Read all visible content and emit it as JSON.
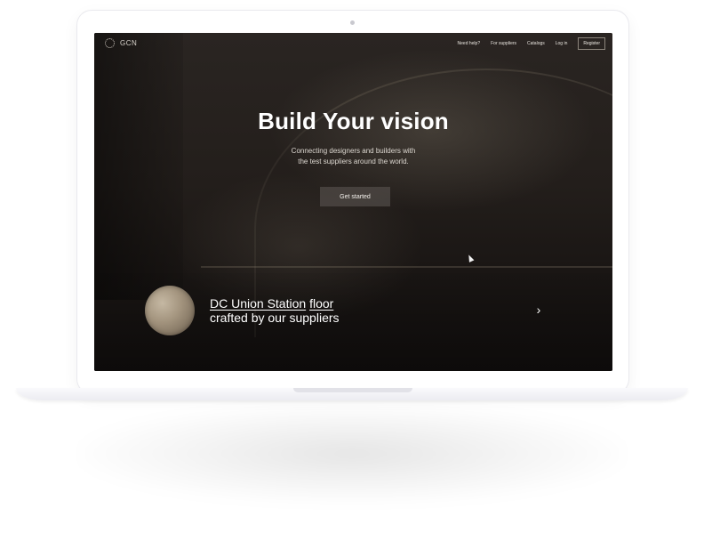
{
  "brand": {
    "logo_text": "GCN",
    "logo_icon": "dotted-ring-icon"
  },
  "nav": {
    "items": [
      {
        "label": "Need help?"
      },
      {
        "label": "For suppliers"
      },
      {
        "label": "Catalogs"
      },
      {
        "label": "Log in"
      }
    ],
    "register_label": "Register"
  },
  "hero": {
    "title": "Build Your vision",
    "subtitle_line1": "Connecting designers and builders with",
    "subtitle_line2": "the test suppliers around the world.",
    "cta_label": "Get started"
  },
  "feature": {
    "link1": "DC Union Station",
    "link2": "floor",
    "line2": "crafted by our suppliers",
    "next_icon": "chevron-right-icon"
  }
}
